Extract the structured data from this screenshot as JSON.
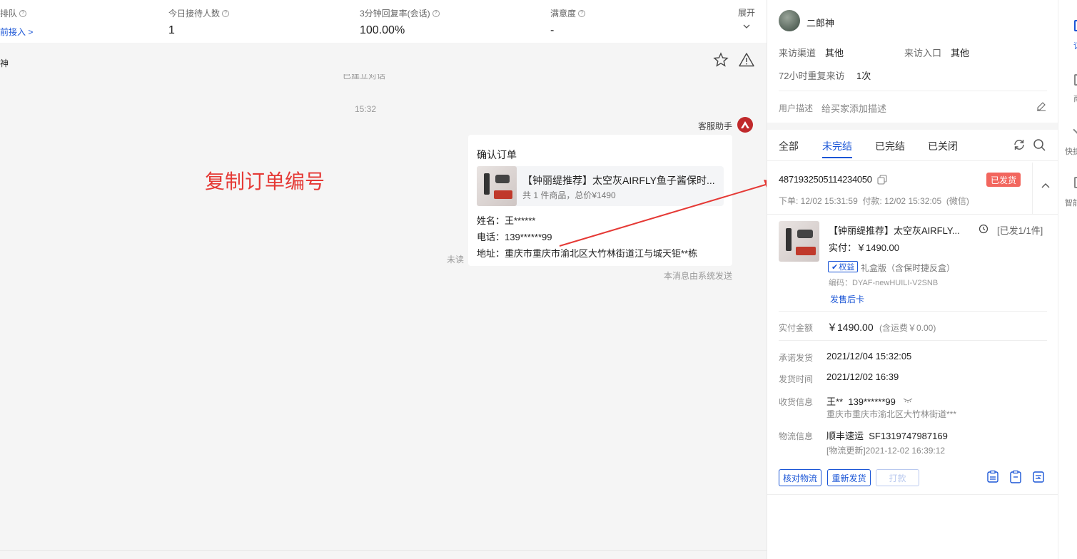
{
  "stats": [
    {
      "label": "排队",
      "value": "前接入 >"
    },
    {
      "label": "今日接待人数",
      "value": "1"
    },
    {
      "label": "3分钟回复率(会话)",
      "value": "100.00%"
    },
    {
      "label": "满意度",
      "value": "-"
    }
  ],
  "stats_expand": "展开",
  "chat": {
    "customer_name": "神",
    "cut_text": "已建立对话",
    "time": "15:32",
    "sender": "客服助手",
    "card_title": "确认订单",
    "product_title": "【钟丽缇推荐】太空灰AIRFLY鱼子酱保时...",
    "product_meta": "共 1 件商品，总价¥1490",
    "name_line": "姓名：王******",
    "phone_line": "电话：139******99",
    "address_line": "地址：重庆市重庆市渝北区大竹林街道江与城天钜**栋",
    "unread": "未读",
    "system_note": "本消息由系统发送",
    "annotation": "复制订单编号"
  },
  "user": {
    "name": "二郎神",
    "channel_label": "来访渠道",
    "channel_value": "其他",
    "entry_label": "来访入口",
    "entry_value": "其他",
    "repeat_label": "72小时重复来访",
    "repeat_value": "1次",
    "desc_label": "用户描述",
    "desc_placeholder": "给买家添加描述"
  },
  "order_tabs": [
    "全部",
    "未完结",
    "已完结",
    "已关闭"
  ],
  "order": {
    "number": "4871932505114234050",
    "status": "已发货",
    "times": "下单: 12/02 15:31:59  付款: 12/02 15:32:05  (微信)",
    "product_title": "【钟丽缇推荐】太空灰AIRFLY...",
    "ship_state": "[已发1/1件]",
    "paid": "实付：￥1490.00",
    "benefit_tag": "权益",
    "variant": "礼盒版（含保时捷反盒）",
    "code": "编码：DYAF-newHUILI-V2SNB",
    "after_sale": "发售后卡",
    "amount_label": "实付金额",
    "amount_value": "￥1490.00",
    "amount_note": "(含运费￥0.00)",
    "promise_label": "承诺发货",
    "promise_value": "2021/12/04 15:32:05",
    "ship_label": "发货时间",
    "ship_value": "2021/12/02 16:39",
    "recv_label": "收货信息",
    "recv_value": "王**  139******99",
    "recv_addr": "重庆市重庆市渝北区大竹林街道***",
    "logi_label": "物流信息",
    "logi_value": "顺丰速运  SF1319747987169",
    "logi_update": "[物流更新]2021-12-02 16:39:12",
    "btn_check": "核对物流",
    "btn_reship": "重新发货",
    "btn_print": "打款"
  },
  "side": [
    "订",
    "商",
    "快捷",
    "智能"
  ],
  "colors": {
    "accent": "#1a55d6",
    "status_bg": "#f2665e",
    "annotation": "#e53935"
  }
}
